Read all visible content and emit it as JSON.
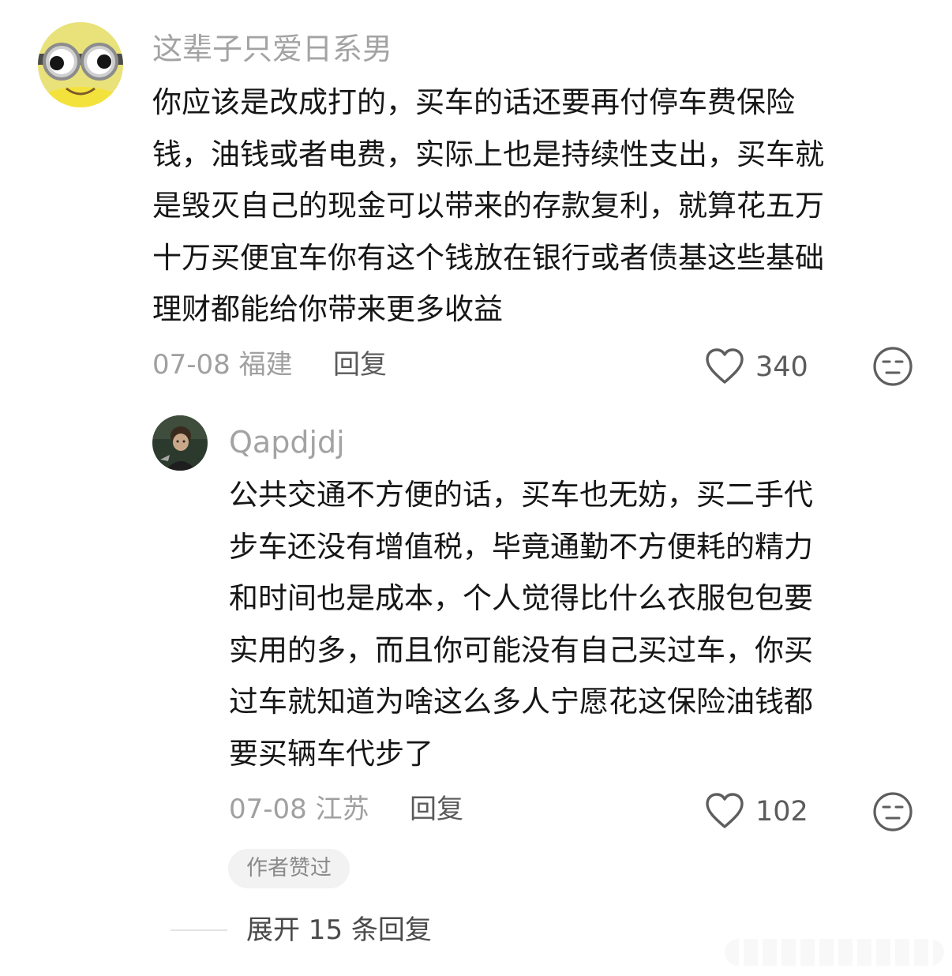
{
  "comments": [
    {
      "username": "这辈子只爱日系男",
      "text_lines": [
        "你应该是改成打的，买车的话还要再付停车费保险",
        "钱，油钱或者电费，实际上也是持续性支出，买车就",
        "是毁灭自己的现金可以带来的存款复利，就算花五万",
        "十万买便宜车你有这个钱放在银行或者债基这些基础",
        "理财都能给你带来更多收益"
      ],
      "date_location": "07-08 福建",
      "reply_label": "回复",
      "like_count": "340",
      "avatar_icon": "minion-avatar",
      "like_icon": "heart-outline-icon",
      "reaction_icon": "meh-face-icon"
    },
    {
      "username": "Qapdjdj",
      "text_lines": [
        "公共交通不方便的话，买车也无妨，买二手代",
        "步车还没有增值税，毕竟通勤不方便耗的精力",
        "和时间也是成本，个人觉得比什么衣服包包要",
        "实用的多，而且你可能没有自己买过车，你买",
        "过车就知道为啥这么多人宁愿花这保险油钱都",
        "要买辆车代步了"
      ],
      "date_location": "07-08 江苏",
      "reply_label": "回复",
      "like_count": "102",
      "badge": "作者赞过",
      "avatar_icon": "photo-avatar",
      "like_icon": "heart-outline-icon",
      "reaction_icon": "meh-face-icon"
    }
  ],
  "expand_replies": "展开 15 条回复",
  "colors": {
    "text_primary": "#161616",
    "text_secondary": "#a0a0a0",
    "badge_bg": "#f2f2f2",
    "icon_gray": "#6a6a6a"
  }
}
